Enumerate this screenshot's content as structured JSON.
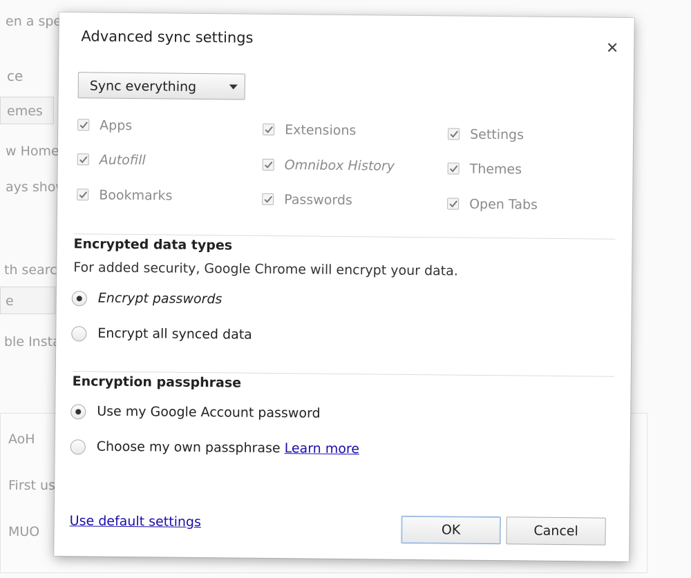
{
  "background": {
    "fragments": [
      "en a spec",
      "ce",
      "emes",
      "w Home",
      "ays show",
      "th search",
      "e",
      "ble Instan",
      "AoH",
      "First us",
      "MUO"
    ]
  },
  "dialog": {
    "title": "Advanced sync settings",
    "close_icon": "close-icon",
    "sync_select": {
      "value": "Sync everything"
    },
    "data_types": [
      {
        "label": "Apps",
        "checked": true
      },
      {
        "label": "Extensions",
        "checked": true
      },
      {
        "label": "Settings",
        "checked": true
      },
      {
        "label": "Autofill",
        "checked": true
      },
      {
        "label": "Omnibox History",
        "checked": true
      },
      {
        "label": "Themes",
        "checked": true
      },
      {
        "label": "Bookmarks",
        "checked": true
      },
      {
        "label": "Passwords",
        "checked": true
      },
      {
        "label": "Open Tabs",
        "checked": true
      }
    ],
    "encrypted": {
      "heading": "Encrypted data types",
      "description": "For added security, Google Chrome will encrypt your data.",
      "options": [
        {
          "label": "Encrypt passwords",
          "selected": true
        },
        {
          "label": "Encrypt all synced data",
          "selected": false
        }
      ]
    },
    "passphrase": {
      "heading": "Encryption passphrase",
      "options": [
        {
          "label": "Use my Google Account password",
          "selected": true
        },
        {
          "label": "Choose my own passphrase",
          "selected": false,
          "link": "Learn more"
        }
      ]
    },
    "footer": {
      "default_link": "Use default settings",
      "ok": "OK",
      "cancel": "Cancel"
    }
  },
  "colors": {
    "link": "#1a0dab",
    "disabled_text": "#8b8b8b",
    "ok_border": "#7aa3d8"
  }
}
